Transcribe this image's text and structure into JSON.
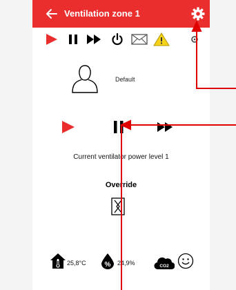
{
  "header": {
    "title": "Ventilation zone 1",
    "back_icon": "arrow-left-icon",
    "settings_icon": "gear-icon",
    "background": "#ea2e2e"
  },
  "toolbar": {
    "icons": [
      "play-icon",
      "pause-icon",
      "fast-forward-icon",
      "power-icon",
      "envelope-icon",
      "warning-icon",
      "settings-icon"
    ]
  },
  "profile": {
    "icon": "user-silhouette-icon",
    "label": "Default"
  },
  "controls": {
    "icons": [
      "play-icon",
      "pause-icon",
      "fast-forward-icon"
    ],
    "active_color": "#ea2e2e"
  },
  "status": {
    "power_text": "Current ventilator power level 1"
  },
  "override": {
    "label": "Override",
    "icon": "override-icon"
  },
  "environment": {
    "temperature": "25,8°C",
    "humidity": "24,9%",
    "co2_label": "CO2",
    "mood_icon": "smiley-icon"
  },
  "annotation_color": "#e00000"
}
